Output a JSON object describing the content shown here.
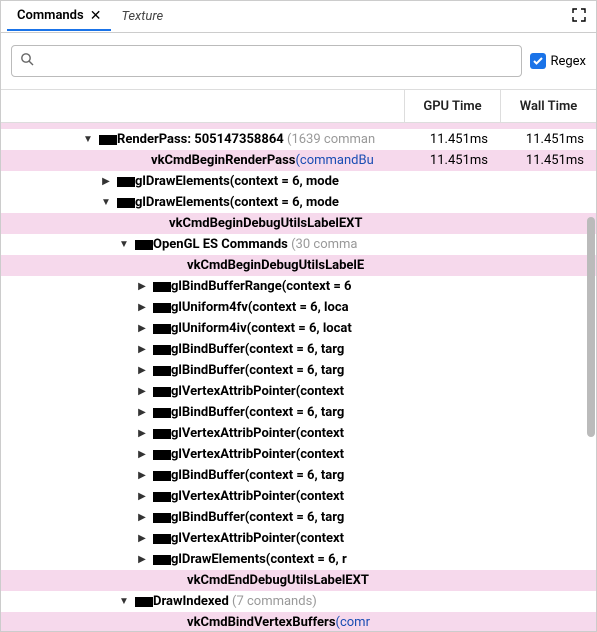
{
  "tabs": {
    "active": "Commands",
    "inactive": "Texture"
  },
  "search": {
    "placeholder": "",
    "icon": "Q",
    "regex_label": "Regex",
    "regex_checked": true
  },
  "columns": {
    "gpu": "GPU Time",
    "wall": "Wall Time"
  },
  "rows": [
    {
      "level": 0,
      "pink": true,
      "full": true
    },
    {
      "level": 1,
      "toggle": "down",
      "redact": 18,
      "bold": "RenderPass: 505147358864",
      "gray": " (1639 comman",
      "gpu": "11.451ms",
      "wall": "11.451ms"
    },
    {
      "level": 2,
      "pink": true,
      "bold": "vkCmdBeginRenderPass",
      "link": "(commandBu",
      "gpu": "11.451ms",
      "wall": "11.451ms"
    },
    {
      "level": 2,
      "toggle": "right",
      "redact": 18,
      "bold": "glDrawElements(context = 6, mode"
    },
    {
      "level": 2,
      "toggle": "down",
      "redact": 18,
      "bold": "glDrawElements(context = 6, mode"
    },
    {
      "level": 3,
      "pink": true,
      "bold": "vkCmdBeginDebugUtilsLabelEXT"
    },
    {
      "level": 3,
      "toggle": "down",
      "redact": 18,
      "bold": "OpenGL ES Commands",
      "gray": " (30 comma"
    },
    {
      "level": 4,
      "pink": true,
      "bold": "vkCmdBeginDebugUtilsLabelE"
    },
    {
      "level": 4,
      "toggle": "right",
      "redact": 18,
      "bold": "glBindBufferRange(context = 6"
    },
    {
      "level": 4,
      "toggle": "right",
      "redact": 18,
      "bold": "glUniform4fv(context = 6, loca"
    },
    {
      "level": 4,
      "toggle": "right",
      "redact": 18,
      "bold": "glUniform4iv(context = 6, locat"
    },
    {
      "level": 4,
      "toggle": "right",
      "redact": 18,
      "bold": "glBindBuffer(context = 6, targ"
    },
    {
      "level": 4,
      "toggle": "right",
      "redact": 18,
      "bold": "glBindBuffer(context = 6, targ"
    },
    {
      "level": 4,
      "toggle": "right",
      "redact": 18,
      "bold": "glVertexAttribPointer(context"
    },
    {
      "level": 4,
      "toggle": "right",
      "redact": 18,
      "bold": "glBindBuffer(context = 6, targ"
    },
    {
      "level": 4,
      "toggle": "right",
      "redact": 18,
      "bold": "glVertexAttribPointer(context"
    },
    {
      "level": 4,
      "toggle": "right",
      "redact": 18,
      "bold": "glVertexAttribPointer(context"
    },
    {
      "level": 4,
      "toggle": "right",
      "redact": 18,
      "bold": "glBindBuffer(context = 6, targ"
    },
    {
      "level": 4,
      "toggle": "right",
      "redact": 18,
      "bold": "glVertexAttribPointer(context"
    },
    {
      "level": 4,
      "toggle": "right",
      "redact": 18,
      "bold": "glBindBuffer(context = 6, targ"
    },
    {
      "level": 4,
      "toggle": "right",
      "redact": 18,
      "bold": "glVertexAttribPointer(context"
    },
    {
      "level": 4,
      "toggle": "right",
      "redact": 18,
      "bold": "glDrawElements(context = 6, r"
    },
    {
      "level": 4,
      "pink": true,
      "bold": "vkCmdEndDebugUtilsLabelEXT"
    },
    {
      "level": 3,
      "toggle": "down",
      "redact": 18,
      "bold": "DrawIndexed",
      "gray": " (7 commands)"
    },
    {
      "level": 4,
      "pink": true,
      "bold": "vkCmdBindVertexBuffers",
      "link": "(comr"
    }
  ]
}
